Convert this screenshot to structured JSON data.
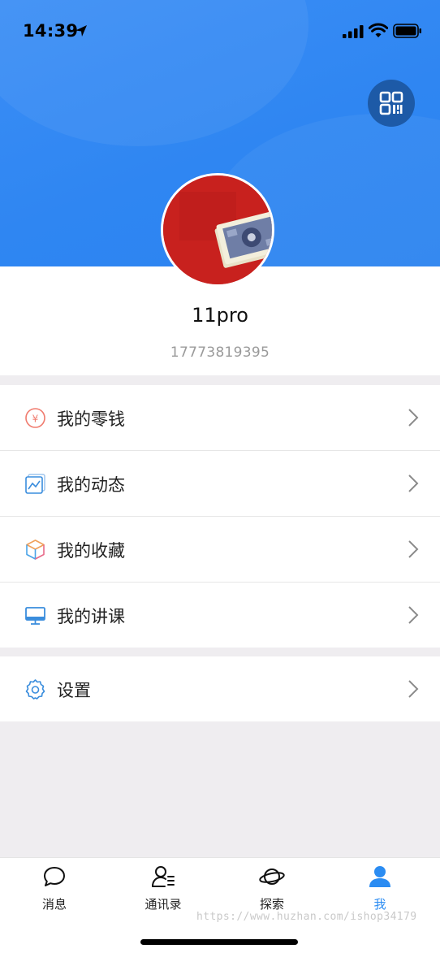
{
  "status_bar": {
    "time": "14:39"
  },
  "profile": {
    "username": "11pro",
    "phone": "17773819395"
  },
  "menu": [
    {
      "label": "我的零钱",
      "icon": "yuan-coin-icon"
    },
    {
      "label": "我的动态",
      "icon": "photo-gallery-icon"
    },
    {
      "label": "我的收藏",
      "icon": "cube-box-icon"
    },
    {
      "label": "我的讲课",
      "icon": "monitor-icon"
    }
  ],
  "settings": {
    "label": "设置",
    "icon": "gear-icon"
  },
  "tabbar": {
    "tabs": [
      {
        "label": "消息",
        "icon": "chat-bubble-icon"
      },
      {
        "label": "通讯录",
        "icon": "contacts-icon"
      },
      {
        "label": "探索",
        "icon": "planet-icon"
      },
      {
        "label": "我",
        "icon": "person-icon"
      }
    ],
    "active_index": 3
  },
  "watermark": "https://www.huzhan.com/ishop34179",
  "colors": {
    "header_blue": "#2f86f2",
    "active_tab": "#2b8cf2",
    "qr_button": "#1d5aa7"
  }
}
